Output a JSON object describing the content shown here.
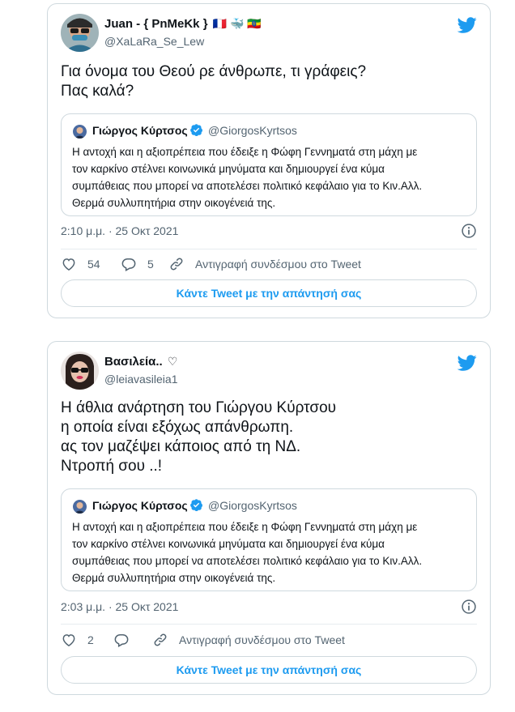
{
  "colors": {
    "accent": "#1d9bf0",
    "text": "#0f1419",
    "secondary": "#536471",
    "border": "#cfd9de"
  },
  "tweets": [
    {
      "user": {
        "display_name": "Juan - { PnMeKk }",
        "emojis": "🇫🇷 🐳 🇪🇹",
        "handle": "@XaLaRa_Se_Lew"
      },
      "text_lines": [
        "Για όνομα του Θεού ρε άνθρωπε, τι γράφεις?",
        "Πας καλά?"
      ],
      "quote": {
        "name": "Γιώργος Κύρτσος",
        "handle": "@GiorgosKyrtsos",
        "text_lines": [
          "Η αντοχή και η αξιοπρέπεια που έδειξε η Φώφη Γεννηματά στη μάχη με",
          "τον καρκίνο στέλνει κοινωνικά μηνύματα και δημιουργεί ένα κύμα",
          "συμπάθειας που μπορεί να αποτελέσει πολιτικό κεφάλαιο για το Κιν.Αλλ.",
          "Θερμά συλλυπητήρια στην οικογένειά της."
        ]
      },
      "timestamp": "2:10 μ.μ. · 25 Οκτ 2021",
      "likes": "54",
      "replies": "5",
      "copy_link_label": "Αντιγραφή συνδέσμου στο Tweet",
      "reply_button_label": "Κάντε Tweet με την απάντησή σας"
    },
    {
      "user": {
        "display_name": "Βασιλεία..",
        "emojis": "♡",
        "handle": "@leiavasileia1"
      },
      "text_lines": [
        "Η άθλια ανάρτηση του Γιώργου Κύρτσου",
        "η οποία είναι εξόχως απάνθρωπη.",
        "ας τον μαζέψει κάποιος από τη ΝΔ.",
        "Ντροπή σου ..!"
      ],
      "quote": {
        "name": "Γιώργος Κύρτσος",
        "handle": "@GiorgosKyrtsos",
        "text_lines": [
          "Η αντοχή και η αξιοπρέπεια που έδειξε η Φώφη Γεννηματά στη μάχη με",
          "τον καρκίνο στέλνει κοινωνικά μηνύματα και δημιουργεί ένα κύμα",
          "συμπάθειας που μπορεί να αποτελέσει πολιτικό κεφάλαιο για το Κιν.Αλλ.",
          "Θερμά συλλυπητήρια στην οικογένειά της."
        ]
      },
      "timestamp": "2:03 μ.μ. · 25 Οκτ 2021",
      "likes": "2",
      "copy_link_label": "Αντιγραφή συνδέσμου στο Tweet",
      "reply_button_label": "Κάντε Tweet με την απάντησή σας"
    }
  ],
  "icons": {
    "brand": "twitter-bird-icon",
    "verified": "verified-badge-icon",
    "info": "info-icon",
    "like": "heart-icon",
    "reply": "reply-bubble-icon",
    "copy_link": "link-icon"
  }
}
